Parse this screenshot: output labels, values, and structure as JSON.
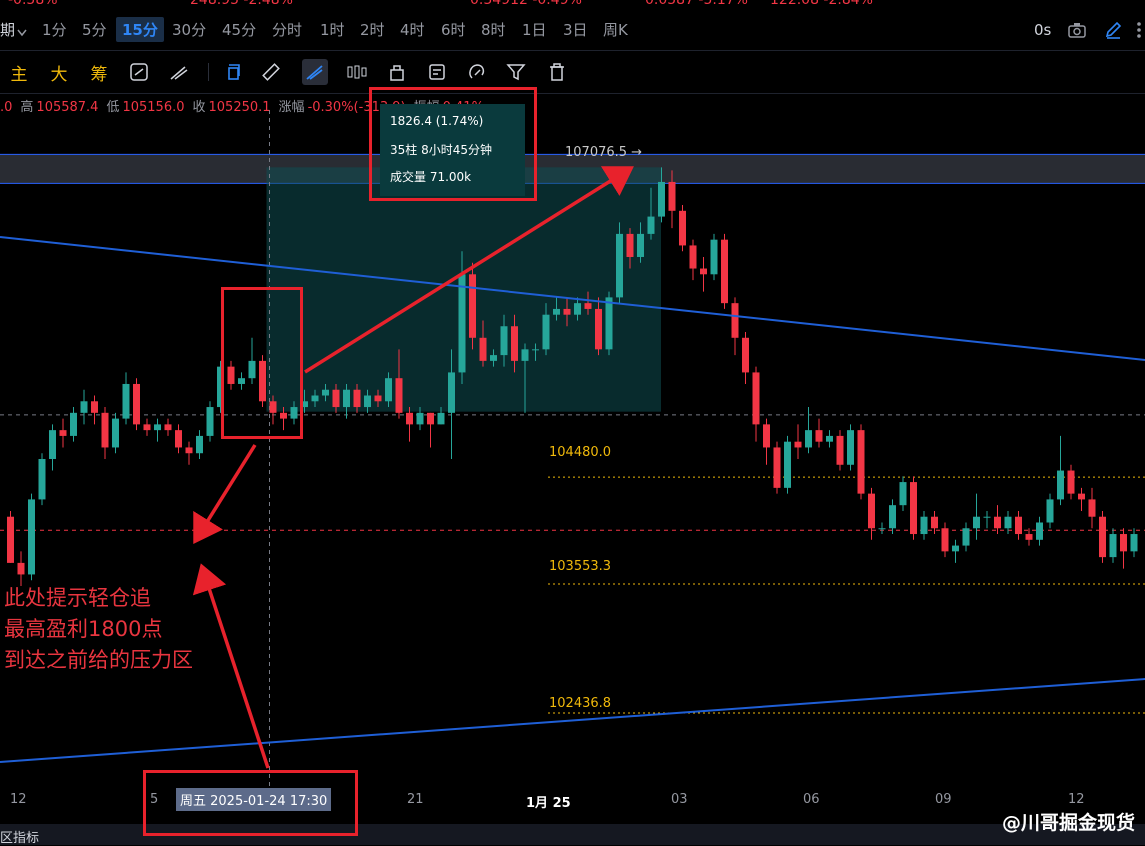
{
  "top_strip": [
    {
      "text": "-0.58%"
    },
    {
      "text": "248.95 -2.48%"
    },
    {
      "text": "0.34912 -0.49%"
    },
    {
      "text": "0.0587 -5.17%"
    },
    {
      "text": "122.08 -2.84%"
    }
  ],
  "timeframes": {
    "period_label": "期",
    "items": [
      "1分",
      "5分",
      "15分",
      "30分",
      "45分",
      "分时",
      "1时",
      "2时",
      "4时",
      "6时",
      "8时",
      "1日",
      "3日",
      "周K"
    ],
    "active": "15分",
    "right_label": "0s"
  },
  "toolbar": {
    "main": "主",
    "big": "大",
    "chip": "筹"
  },
  "ohlc": {
    "open_partial": ".0",
    "high_label": "高",
    "high": "105587.4",
    "low_label": "低",
    "low": "105156.0",
    "close_label": "收",
    "close": "105250.1",
    "change_label": "涨幅",
    "change": "-0.30%(-313.9)",
    "amp_label": "振幅",
    "amp": "0.41%"
  },
  "measure": {
    "line1": "1826.4 (1.74%)",
    "line2": "35柱 8小时45分钟",
    "line3": "成交量 71.00k"
  },
  "price_labels": {
    "peak": "107076.5 →",
    "p1": "104480.0",
    "p2": "103553.3",
    "p3": "102436.8"
  },
  "x_axis": {
    "ticks": [
      "12",
      "5",
      "21",
      "1月 25",
      "03",
      "06",
      "09",
      "12"
    ],
    "crosshair": "周五 2025-01-24 17:30"
  },
  "annotation": {
    "line1": "此处提示轻仓追",
    "line2": "最高盈利1800点",
    "line3": "到达之前给的压力区"
  },
  "bottom_label": "区指标",
  "watermark": "@川哥掘金现货",
  "colors": {
    "up": "#26a69a",
    "down": "#f23645",
    "trend": "#1f5fd6",
    "highlight": "#e8222c",
    "accent": "#2f86f6"
  },
  "chart_data": {
    "type": "candlestick",
    "y_range": [
      101700,
      107400
    ],
    "levels": [
      104480.0,
      103553.3,
      102436.8,
      107076.5
    ],
    "candles": [
      [
        104050,
        103650,
        103650,
        104100
      ],
      [
        103650,
        103550,
        103450,
        103750
      ],
      [
        103550,
        104200,
        103500,
        104250
      ],
      [
        104200,
        104550,
        104150,
        104600
      ],
      [
        104550,
        104800,
        104450,
        104850
      ],
      [
        104800,
        104750,
        104650,
        104900
      ],
      [
        104750,
        104950,
        104700,
        105000
      ],
      [
        104950,
        105050,
        104850,
        105150
      ],
      [
        105050,
        104950,
        104850,
        105100
      ],
      [
        104950,
        104650,
        104550,
        105000
      ],
      [
        104650,
        104900,
        104600,
        104950
      ],
      [
        104900,
        105200,
        104850,
        105300
      ],
      [
        105200,
        104850,
        104800,
        105250
      ],
      [
        104850,
        104800,
        104750,
        104900
      ],
      [
        104800,
        104850,
        104700,
        104900
      ],
      [
        104850,
        104800,
        104750,
        104900
      ],
      [
        104800,
        104650,
        104600,
        104850
      ],
      [
        104650,
        104600,
        104500,
        104700
      ],
      [
        104600,
        104750,
        104550,
        104800
      ],
      [
        104750,
        105000,
        104700,
        105050
      ],
      [
        105000,
        105350,
        104950,
        105400
      ],
      [
        105350,
        105200,
        105150,
        105400
      ],
      [
        105200,
        105250,
        105150,
        105300
      ],
      [
        105250,
        105400,
        105200,
        105600
      ],
      [
        105400,
        105050,
        105000,
        105450
      ],
      [
        105050,
        104950,
        104850,
        105100
      ],
      [
        104950,
        104900,
        104800,
        105000
      ],
      [
        104900,
        105000,
        104850,
        105050
      ],
      [
        105000,
        105050,
        104950,
        105150
      ],
      [
        105050,
        105100,
        105000,
        105150
      ],
      [
        105100,
        105150,
        105050,
        105200
      ],
      [
        105150,
        105000,
        104950,
        105200
      ],
      [
        105000,
        105150,
        104900,
        105200
      ],
      [
        105150,
        105000,
        104950,
        105200
      ],
      [
        105000,
        105100,
        104950,
        105150
      ],
      [
        105100,
        105050,
        105000,
        105150
      ],
      [
        105050,
        105250,
        105000,
        105300
      ],
      [
        105250,
        104950,
        104900,
        105500
      ],
      [
        104950,
        104850,
        104700,
        105000
      ],
      [
        104850,
        104950,
        104800,
        105000
      ],
      [
        104950,
        104850,
        104650,
        104950
      ],
      [
        104850,
        104950,
        104850,
        105000
      ],
      [
        104950,
        105300,
        104550,
        105500
      ],
      [
        105300,
        106150,
        105200,
        106350
      ],
      [
        106150,
        105600,
        105500,
        106250
      ],
      [
        105600,
        105400,
        105350,
        105750
      ],
      [
        105400,
        105450,
        105350,
        105500
      ],
      [
        105450,
        105700,
        105350,
        105800
      ],
      [
        105700,
        105400,
        105300,
        105800
      ],
      [
        105400,
        105500,
        104950,
        105550
      ],
      [
        105500,
        105500,
        105400,
        105550
      ],
      [
        105500,
        105800,
        105450,
        105900
      ],
      [
        105800,
        105850,
        105750,
        105950
      ],
      [
        105850,
        105800,
        105700,
        105950
      ],
      [
        105800,
        105900,
        105750,
        105950
      ],
      [
        105900,
        105850,
        105800,
        106000
      ],
      [
        105850,
        105500,
        105450,
        105950
      ],
      [
        105500,
        105950,
        105450,
        106000
      ],
      [
        105950,
        106500,
        105900,
        106600
      ],
      [
        106500,
        106300,
        106200,
        106550
      ],
      [
        106300,
        106500,
        106250,
        106600
      ],
      [
        106500,
        106650,
        106450,
        106900
      ],
      [
        106650,
        106950,
        106600,
        107076
      ],
      [
        106950,
        106700,
        106550,
        107050
      ],
      [
        106700,
        106400,
        106350,
        106750
      ],
      [
        106400,
        106200,
        106100,
        106450
      ],
      [
        106200,
        106150,
        106000,
        106300
      ],
      [
        106150,
        106450,
        106100,
        106500
      ],
      [
        106450,
        105900,
        105850,
        106500
      ],
      [
        105900,
        105600,
        105450,
        105950
      ],
      [
        105600,
        105300,
        105200,
        105650
      ],
      [
        105300,
        104850,
        104700,
        105350
      ],
      [
        104850,
        104650,
        104500,
        104900
      ],
      [
        104650,
        104300,
        104250,
        104700
      ],
      [
        104300,
        104700,
        104250,
        104750
      ],
      [
        104700,
        104650,
        104550,
        104850
      ],
      [
        104650,
        104800,
        104600,
        105000
      ],
      [
        104800,
        104700,
        104650,
        104900
      ],
      [
        104700,
        104750,
        104650,
        104800
      ],
      [
        104750,
        104500,
        104450,
        104800
      ],
      [
        104500,
        104800,
        104450,
        104850
      ],
      [
        104800,
        104250,
        104200,
        104850
      ],
      [
        104250,
        103950,
        103850,
        104300
      ],
      [
        103950,
        103950,
        103900,
        104000
      ],
      [
        103950,
        104150,
        103900,
        104200
      ],
      [
        104150,
        104350,
        104100,
        104400
      ],
      [
        104350,
        103900,
        103850,
        104400
      ],
      [
        103900,
        104050,
        103850,
        104100
      ],
      [
        104050,
        103950,
        103900,
        104100
      ],
      [
        103950,
        103750,
        103700,
        104000
      ],
      [
        103750,
        103800,
        103650,
        103850
      ],
      [
        103800,
        103950,
        103750,
        104000
      ],
      [
        103950,
        104050,
        103850,
        104250
      ],
      [
        104050,
        104050,
        103950,
        104100
      ],
      [
        104050,
        103950,
        103900,
        104150
      ],
      [
        103950,
        104050,
        103900,
        104100
      ],
      [
        104050,
        103900,
        103850,
        104100
      ],
      [
        103900,
        103850,
        103800,
        103950
      ],
      [
        103850,
        104000,
        103800,
        104050
      ],
      [
        104000,
        104200,
        103950,
        104250
      ],
      [
        104200,
        104450,
        104150,
        104750
      ],
      [
        104450,
        104250,
        104200,
        104500
      ],
      [
        104250,
        104200,
        104100,
        104300
      ],
      [
        104200,
        104050,
        103950,
        104300
      ],
      [
        104050,
        103700,
        103650,
        104100
      ],
      [
        103700,
        103900,
        103650,
        103950
      ],
      [
        103900,
        103750,
        103600,
        103950
      ],
      [
        103750,
        103900,
        103700,
        103950
      ]
    ]
  }
}
